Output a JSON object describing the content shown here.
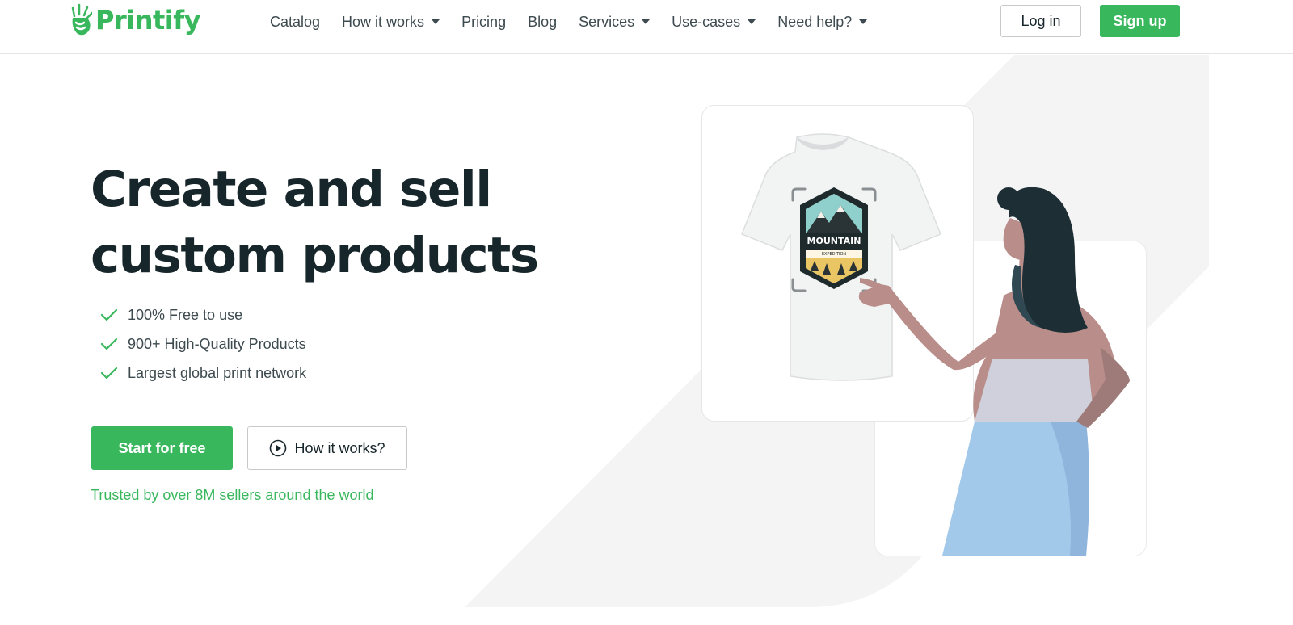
{
  "brand": {
    "name": "Printify",
    "color": "#39b75d"
  },
  "nav": {
    "items": [
      {
        "label": "Catalog",
        "dropdown": false
      },
      {
        "label": "How it works",
        "dropdown": true
      },
      {
        "label": "Pricing",
        "dropdown": false
      },
      {
        "label": "Blog",
        "dropdown": false
      },
      {
        "label": "Services",
        "dropdown": true
      },
      {
        "label": "Use-cases",
        "dropdown": true
      },
      {
        "label": "Need help?",
        "dropdown": true
      }
    ],
    "login_label": "Log in",
    "signup_label": "Sign up"
  },
  "hero": {
    "title_line1": "Create and sell",
    "title_line2": "custom products",
    "features": [
      "100% Free to use",
      "900+ High-Quality Products",
      "Largest global print network"
    ],
    "start_label": "Start for free",
    "how_label": "How it works?",
    "trusted_text": "Trusted by over 8M sellers around the world"
  },
  "illustration": {
    "badge_title": "MOUNTAIN",
    "badge_subtitle": "EXPEDITION"
  },
  "colors": {
    "accent": "#39b75d",
    "text_dark": "#17262b",
    "background_shape": "#f4f4f4"
  }
}
